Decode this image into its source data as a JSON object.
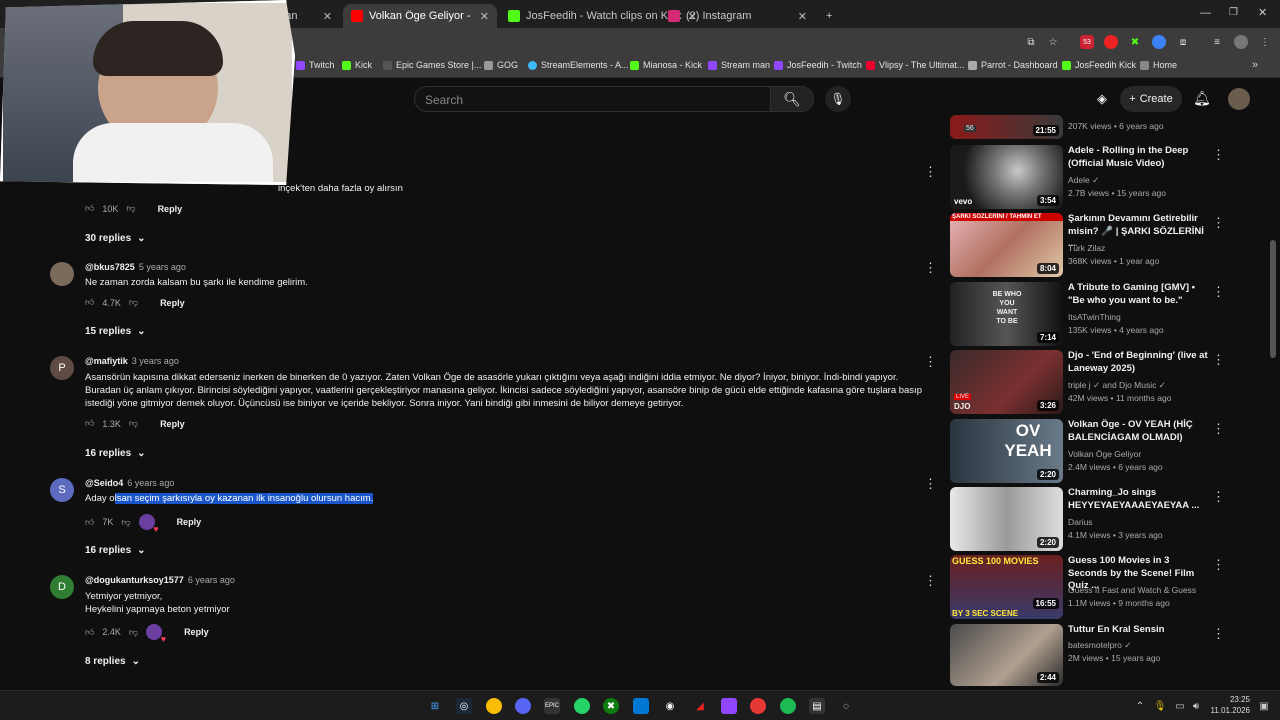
{
  "browser": {
    "tabs": [
      {
        "label": "Kağızman",
        "active": false
      },
      {
        "label": "Volkan Öge Geliyor - Seçim Şa...",
        "active": true
      },
      {
        "label": "JosFeedih - Watch clips on Kick",
        "active": false
      },
      {
        "label": "(2) Instagram",
        "active": false
      }
    ],
    "new_tab": "+",
    "bookmarks": [
      "Twitch",
      "Kick",
      "Epic Games Store |...",
      "GOG",
      "StreamElements - A...",
      "Mianosa - Kick",
      "Stream man",
      "JosFeedih - Twitch",
      "Vlipsy - The Ultimat...",
      "Parrot - Dashboard",
      "JosFeedih Kick",
      "Home"
    ],
    "ext_badge": "53"
  },
  "header": {
    "search_placeholder": "Search",
    "create_label": "Create"
  },
  "comments": [
    {
      "partial_text": "inçek'ten daha fazla oy alırsın",
      "likes": "10K",
      "reply": "Reply",
      "replies": "30 replies"
    },
    {
      "handle": "@bkus7825",
      "time": "5 years ago",
      "text": "Ne zaman zorda kalsam bu şarkı ile kendime gelirim.",
      "likes": "4.7K",
      "reply": "Reply",
      "replies": "15 replies"
    },
    {
      "handle": "@mafiytik",
      "time": "3 years ago",
      "avatar": "P",
      "text": "Asansörün kapısına dikkat ederseniz inerken de binerken de 0 yazıyor. Zaten Volkan Öge de asasörle yukarı çıktığını veya aşağı indiğini iddia etmiyor. Ne diyor? İniyor, biniyor. İndi-bindi yapıyor. Buradan üç anlam çıkıyor. Birincisi söylediğini yapıyor, vaatlerini gerçekleştiriyor manasına geliyor. İkincisi sadece söylediğini yapıyor, asansöre binip de gücü elde ettiğinde kafasına göre tuşlara basıp istediği yöne gitmiyor demek oluyor. Üçüncüsü ise biniyor ve içeride bekliyor. Sonra iniyor. Yani bindiği gibi inmesini de biliyor demeye getiriyor.",
      "likes": "1.3K",
      "reply": "Reply",
      "replies": "16 replies"
    },
    {
      "handle": "@Seido4",
      "time": "6 years ago",
      "avatar": "S",
      "text_prefix": "Aday o",
      "text_highlight": "lsan seçim şarkısıyla oy kazanan ilk insanoğlu olursun hacım.",
      "likes": "7K",
      "reply": "Reply",
      "replies": "16 replies"
    },
    {
      "handle": "@dogukanturksoy1577",
      "time": "6 years ago",
      "avatar": "D",
      "line1": "Yetmiyor yetmiyor,",
      "line2": "Heykelini yapmaya beton yetmiyor",
      "likes": "2.4K",
      "reply": "Reply",
      "replies": "8 replies"
    }
  ],
  "sidebar": [
    {
      "title": "",
      "channel": "",
      "meta": "207K views • 6 years ago",
      "duration": "21:55"
    },
    {
      "title": "Adele - Rolling in the Deep (Official Music Video)",
      "channel": "Adele",
      "meta": "2.7B views • 15 years ago",
      "duration": "3:54",
      "verified": true
    },
    {
      "title": "Şarkının Devamını Getirebilir misin? 🎤 | ŞARKI SÖZLERİNİ ...",
      "channel": "Türk Zilaz",
      "meta": "368K views • 1 year ago",
      "duration": "8:04"
    },
    {
      "title": "A Tribute to Gaming [GMV] • \"Be who you want to be.\"",
      "channel": "ItsATwinThing",
      "meta": "135K views • 4 years ago",
      "duration": "7:14"
    },
    {
      "title": "Djo - 'End of Beginning' (live at Laneway 2025)",
      "channel": "triple j ✓ and Djo Music ✓",
      "meta": "42M views • 11 months ago",
      "duration": "3:26"
    },
    {
      "title": "Volkan Öge - OV YEAH (HİÇ BALENCİAGAM OLMADI)",
      "channel": "Volkan Öge Geliyor",
      "meta": "2.4M views • 6 years ago",
      "duration": "2:20"
    },
    {
      "title": "Charming_Jo sings HEYYEYAEYAAAEYAEYAA ...",
      "channel": "Darius",
      "meta": "4.1M views • 3 years ago",
      "duration": "2:20"
    },
    {
      "title": "Guess 100 Movies in 3 Seconds by the Scene! Film Quiz ...",
      "channel": "Guess It Fast and Watch & Guess",
      "meta": "1.1M views • 9 months ago",
      "duration": "16:55"
    },
    {
      "title": "Tuttur En Kral Sensin",
      "channel": "batesmotelpro",
      "meta": "2M views • 15 years ago",
      "duration": "2:44",
      "verified": true
    }
  ],
  "sidebar_thumb_text": {
    "ov_yeah": "OV YEAH",
    "guess": "GUESS 100 MOVIES",
    "by3": "BY 3 SEC SCENE",
    "sarki": "ŞARKI SÖZLERİNİ / TAHMİN ET",
    "be_who": "BE WHO YOU WANT TO BE",
    "vevo": "vevo",
    "live": "LIVE",
    "djo": "DJO",
    "count56": "56"
  },
  "taskbar": {
    "time": "23:25",
    "date": "11.01.2026"
  },
  "colors": {
    "highlight": "#1a56c9",
    "bg": "#0f0f0f"
  }
}
